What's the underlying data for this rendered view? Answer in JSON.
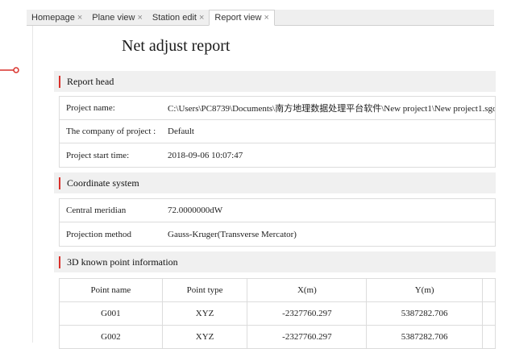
{
  "tabs": [
    {
      "label": "Homepage",
      "close": "×",
      "active": false
    },
    {
      "label": "Plane view",
      "close": "×",
      "active": false
    },
    {
      "label": "Station edit",
      "close": "×",
      "active": false
    },
    {
      "label": "Report view",
      "close": "×",
      "active": true
    }
  ],
  "report": {
    "title": "Net adjust report",
    "sections": {
      "report_head": "Report head",
      "coordinate_system": "Coordinate system",
      "known_points": "3D known point information"
    },
    "report_head_rows": [
      {
        "key": "Project name:",
        "value": "C:\\Users\\PC8739\\Documents\\南方地理数据处理平台软件\\New project1\\New project1.sgo"
      },
      {
        "key": "The company of project :",
        "value": "Default"
      },
      {
        "key": "Project start time:",
        "value": "2018-09-06 10:07:47"
      }
    ],
    "coordinate_rows": [
      {
        "key": "Central meridian",
        "value": "72.0000000dW"
      },
      {
        "key": "Projection method",
        "value": "Gauss-Kruger(Transverse Mercator)"
      }
    ],
    "point_table": {
      "headers": [
        "Point name",
        "Point type",
        "X(m)",
        "Y(m)",
        ""
      ],
      "rows": [
        [
          "G001",
          "XYZ",
          "-2327760.297",
          "5387282.706",
          ""
        ],
        [
          "G002",
          "XYZ",
          "-2327760.297",
          "5387282.706",
          ""
        ]
      ]
    }
  },
  "colors": {
    "section_accent": "#d9312b",
    "connector": "#d9312b"
  },
  "icons": {
    "connector": "connector-pin-icon"
  }
}
